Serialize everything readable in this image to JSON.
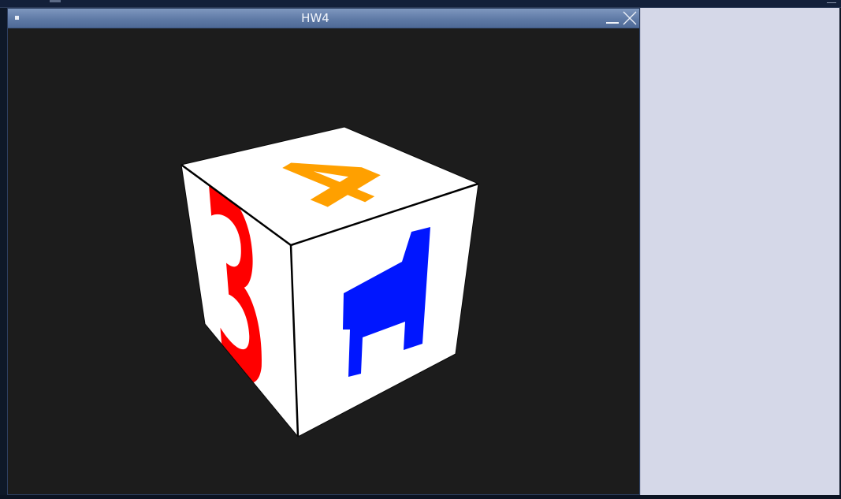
{
  "window": {
    "title": "HW4"
  },
  "cube": {
    "top_face_glyph": "4",
    "left_face_glyph": "3",
    "front_face_glyph": "h",
    "colors": {
      "top_glyph": "#ffa000",
      "left_glyph": "#ff0000",
      "front_glyph": "#0016ff",
      "face": "#ffffff",
      "edge": "#000000",
      "background": "#1c1c1c"
    }
  },
  "icons": {
    "window_menu": "square-dot-icon",
    "minimize": "minimize-icon",
    "close": "close-icon"
  },
  "colors": {
    "titlebar": "#6a85b0",
    "side_panel": "#d5d8e8",
    "desktop": "#0e1828"
  }
}
